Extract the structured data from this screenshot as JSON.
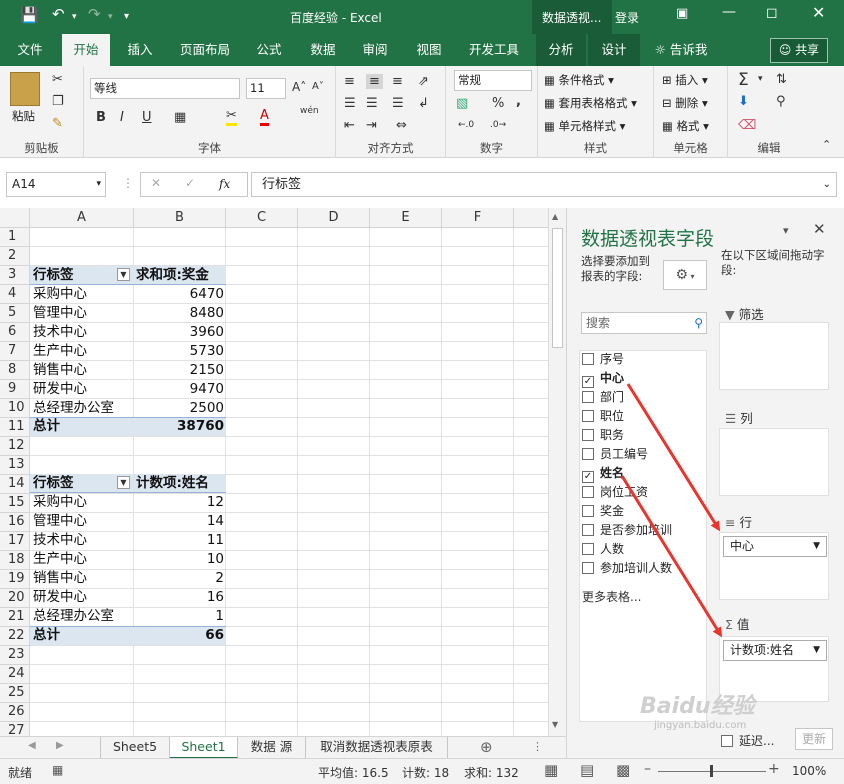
{
  "window": {
    "title": "百度经验 - Excel",
    "context_tab": "数据透视...",
    "login": "登录"
  },
  "ribbon_tabs": [
    "文件",
    "开始",
    "插入",
    "页面布局",
    "公式",
    "数据",
    "审阅",
    "视图",
    "开发工具",
    "分析",
    "设计"
  ],
  "tell_me": "告诉我",
  "share": "共享",
  "clipboard": {
    "paste": "粘贴",
    "label": "剪贴板"
  },
  "font": {
    "name": "等线",
    "size": "11",
    "label": "字体",
    "bold": "B",
    "italic": "I",
    "underline": "U",
    "font_color": "A",
    "phonetic": "wén"
  },
  "alignment": {
    "label": "对齐方式"
  },
  "number": {
    "format": "常规",
    "label": "数字",
    "percent": "%",
    "comma": ","
  },
  "styles": {
    "conditional": "条件格式",
    "table": "套用表格格式",
    "cell": "单元格样式",
    "label": "样式"
  },
  "cells": {
    "insert": "插入",
    "delete": "删除",
    "format": "格式",
    "label": "单元格"
  },
  "editing": {
    "label": "编辑"
  },
  "formula_bar": {
    "name_box": "A14",
    "fx": "fx",
    "content": "行标签"
  },
  "columns": [
    "A",
    "B",
    "C",
    "D",
    "E",
    "F"
  ],
  "rows": [
    "1",
    "2",
    "3",
    "4",
    "5",
    "6",
    "7",
    "8",
    "9",
    "10",
    "11",
    "12",
    "13",
    "14",
    "15",
    "16",
    "17",
    "18",
    "19",
    "20",
    "21",
    "22",
    "23",
    "24",
    "25",
    "26",
    "27"
  ],
  "pivot1": {
    "header_a": "行标签",
    "header_b": "求和项:奖金",
    "rows": [
      {
        "label": "采购中心",
        "value": "6470"
      },
      {
        "label": "管理中心",
        "value": "8480"
      },
      {
        "label": "技术中心",
        "value": "3960"
      },
      {
        "label": "生产中心",
        "value": "5730"
      },
      {
        "label": "销售中心",
        "value": "2150"
      },
      {
        "label": "研发中心",
        "value": "9470"
      },
      {
        "label": "总经理办公室",
        "value": "2500"
      }
    ],
    "total_label": "总计",
    "total_value": "38760"
  },
  "pivot2": {
    "header_a": "行标签",
    "header_b": "计数项:姓名",
    "rows": [
      {
        "label": "采购中心",
        "value": "12"
      },
      {
        "label": "管理中心",
        "value": "14"
      },
      {
        "label": "技术中心",
        "value": "11"
      },
      {
        "label": "生产中心",
        "value": "10"
      },
      {
        "label": "销售中心",
        "value": "2"
      },
      {
        "label": "研发中心",
        "value": "16"
      },
      {
        "label": "总经理办公室",
        "value": "1"
      }
    ],
    "total_label": "总计",
    "total_value": "66"
  },
  "sheet_tabs": [
    "Sheet5",
    "Sheet1",
    "数据 源",
    "取消数据透视表原表"
  ],
  "active_sheet": "Sheet1",
  "status": {
    "ready": "就绪",
    "average": "平均值: 16.5",
    "count": "计数: 18",
    "sum": "求和: 132",
    "zoom": "100%"
  },
  "pane": {
    "title": "数据透视表字段",
    "choose_label": "选择要添加到报表的字段:",
    "drag_label": "在以下区域间拖动字段:",
    "search_placeholder": "搜索",
    "fields": [
      {
        "name": "序号",
        "checked": false,
        "bold": false
      },
      {
        "name": "中心",
        "checked": true,
        "bold": true
      },
      {
        "name": "部门",
        "checked": false,
        "bold": false
      },
      {
        "name": "职位",
        "checked": false,
        "bold": false
      },
      {
        "name": "职务",
        "checked": false,
        "bold": false
      },
      {
        "name": "员工编号",
        "checked": false,
        "bold": false
      },
      {
        "name": "姓名",
        "checked": true,
        "bold": true
      },
      {
        "name": "岗位工资",
        "checked": false,
        "bold": false
      },
      {
        "name": "奖金",
        "checked": false,
        "bold": false
      },
      {
        "name": "是否参加培训",
        "checked": false,
        "bold": false
      },
      {
        "name": "人数",
        "checked": false,
        "bold": false
      },
      {
        "name": "参加培训人数",
        "checked": false,
        "bold": false
      }
    ],
    "more_tables": "更多表格...",
    "area_filter": "筛选",
    "area_columns": "列",
    "area_rows": "行",
    "area_values": "值",
    "rows_field": "中心",
    "values_field": "计数项:姓名",
    "defer": "延迟...",
    "update": "更新"
  },
  "watermark": {
    "brand": "Baidu经验",
    "url": "jingyan.baidu.com"
  },
  "colors": {
    "excel_green": "#217346",
    "pivot_band": "#dce6f1",
    "arrow_red": "#e8352e"
  }
}
